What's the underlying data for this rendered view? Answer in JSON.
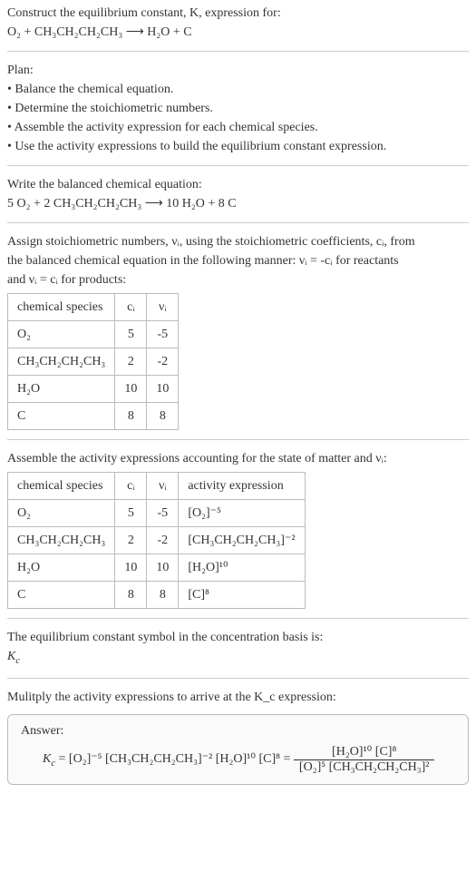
{
  "prompt": {
    "line1": "Construct the equilibrium constant, K, expression for:",
    "equation_unbalanced": "O₂ + CH₃CH₂CH₂CH₃  ⟶  H₂O + C"
  },
  "plan": {
    "heading": "Plan:",
    "b1": "• Balance the chemical equation.",
    "b2": "• Determine the stoichiometric numbers.",
    "b3": "• Assemble the activity expression for each chemical species.",
    "b4": "• Use the activity expressions to build the equilibrium constant expression."
  },
  "balanced": {
    "heading": "Write the balanced chemical equation:",
    "equation": "5 O₂ + 2 CH₃CH₂CH₂CH₃  ⟶  10 H₂O + 8 C"
  },
  "stoich_text": {
    "line1": "Assign stoichiometric numbers, νᵢ, using the stoichiometric coefficients, cᵢ, from",
    "line2": "the balanced chemical equation in the following manner: νᵢ = -cᵢ for reactants",
    "line3": "and νᵢ = cᵢ for products:"
  },
  "table1": {
    "h1": "chemical species",
    "h2": "cᵢ",
    "h3": "νᵢ",
    "rows": [
      {
        "species": "O₂",
        "c": "5",
        "v": "-5"
      },
      {
        "species": "CH₃CH₂CH₂CH₃",
        "c": "2",
        "v": "-2"
      },
      {
        "species": "H₂O",
        "c": "10",
        "v": "10"
      },
      {
        "species": "C",
        "c": "8",
        "v": "8"
      }
    ]
  },
  "activity_text": "Assemble the activity expressions accounting for the state of matter and νᵢ:",
  "table2": {
    "h1": "chemical species",
    "h2": "cᵢ",
    "h3": "νᵢ",
    "h4": "activity expression",
    "rows": [
      {
        "species": "O₂",
        "c": "5",
        "v": "-5",
        "act": "[O₂]⁻⁵"
      },
      {
        "species": "CH₃CH₂CH₂CH₃",
        "c": "2",
        "v": "-2",
        "act": "[CH₃CH₂CH₂CH₃]⁻²"
      },
      {
        "species": "H₂O",
        "c": "10",
        "v": "10",
        "act": "[H₂O]¹⁰"
      },
      {
        "species": "C",
        "c": "8",
        "v": "8",
        "act": "[C]⁸"
      }
    ]
  },
  "eq_symbol": {
    "line1": "The equilibrium constant symbol in the concentration basis is:",
    "symbol": "K_c"
  },
  "multiply_text": "Mulitply the activity expressions to arrive at the K_c expression:",
  "answer": {
    "label": "Answer:",
    "lhs_prefix": "K_c = ",
    "flat": "[O₂]⁻⁵ [CH₃CH₂CH₂CH₃]⁻² [H₂O]¹⁰ [C]⁸ = ",
    "num": "[H₂O]¹⁰ [C]⁸",
    "den": "[O₂]⁵ [CH₃CH₂CH₂CH₃]²"
  },
  "chart_data": {
    "type": "table",
    "stoichiometric_numbers": {
      "columns": [
        "chemical species",
        "c_i",
        "v_i"
      ],
      "rows": [
        [
          "O2",
          5,
          -5
        ],
        [
          "CH3CH2CH2CH3",
          2,
          -2
        ],
        [
          "H2O",
          10,
          10
        ],
        [
          "C",
          8,
          8
        ]
      ]
    },
    "activity_expressions": {
      "columns": [
        "chemical species",
        "c_i",
        "v_i",
        "activity expression"
      ],
      "rows": [
        [
          "O2",
          5,
          -5,
          "[O2]^-5"
        ],
        [
          "CH3CH2CH2CH3",
          2,
          -2,
          "[CH3CH2CH2CH3]^-2"
        ],
        [
          "H2O",
          10,
          10,
          "[H2O]^10"
        ],
        [
          "C",
          8,
          8,
          "[C]^8"
        ]
      ]
    },
    "balanced_equation": "5 O2 + 2 CH3CH2CH2CH3 -> 10 H2O + 8 C",
    "Kc": "[H2O]^10 [C]^8 / ([O2]^5 [CH3CH2CH2CH3]^2)"
  }
}
